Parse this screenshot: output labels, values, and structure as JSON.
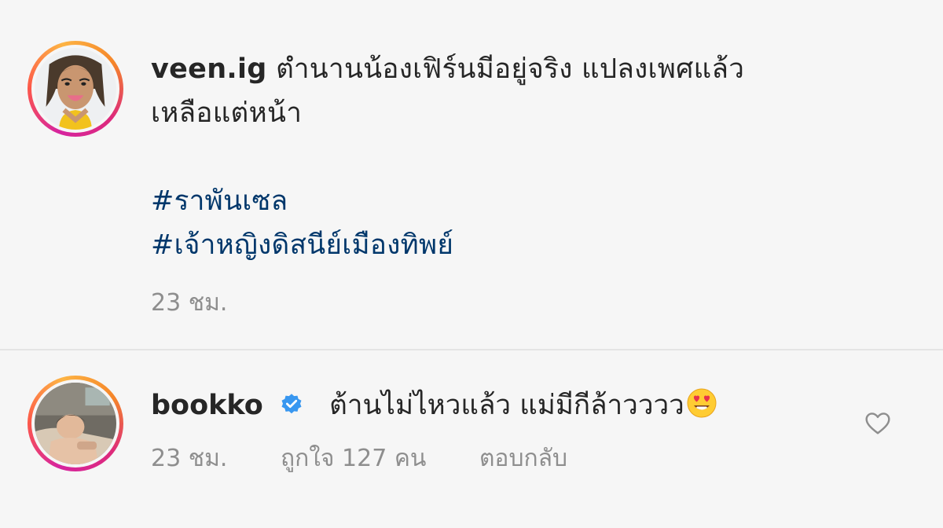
{
  "post": {
    "username": "veen.ig",
    "caption_line1": "ตำนานน้องเฟิร์นมีอยู่จริง แปลงเพศแล้ว",
    "caption_line2": "เหลือแต่หน้า",
    "hashtags": [
      "#ราพันเซล",
      "#เจ้าหญิงดิสนีย์เมืองทิพย์"
    ],
    "time": "23 ชม."
  },
  "comment": {
    "username": "bookko",
    "verified_icon": "verified-badge-icon",
    "text": "ต้านไม่ไหวแล้ว แม่มีกีล้าวววว",
    "emoji": "heart-eyes-emoji",
    "time": "23 ชม.",
    "likes": "ถูกใจ 127 คน",
    "reply_label": "ตอบกลับ",
    "like_icon": "heart-outline-icon"
  },
  "colors": {
    "text": "#262626",
    "secondary": "#8e8e8e",
    "hashtag": "#00376b",
    "verified": "#3897f0",
    "background": "#f6f6f6"
  }
}
